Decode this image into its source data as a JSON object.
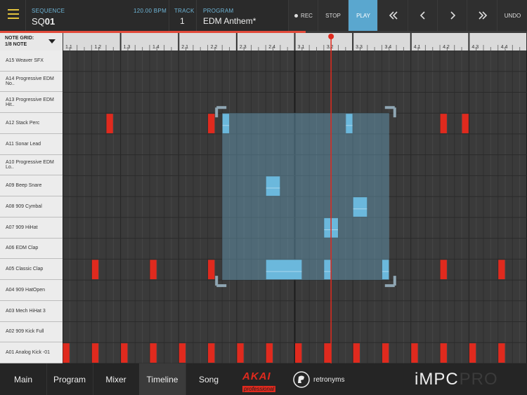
{
  "header": {
    "sequence_label": "SEQUENCE",
    "sequence_prefix": "SQ",
    "sequence_number": "01",
    "bpm": "120.00 BPM",
    "track_label": "TRACK",
    "track_value": "1",
    "program_label": "PROGRAM",
    "program_value": "EDM Anthem*",
    "rec_label": "REC",
    "stop_label": "STOP",
    "play_label": "PLAY",
    "undo_label": "UNDO",
    "song_progress": 0.58
  },
  "note_grid": {
    "label": "NOTE GRID:",
    "value": "1/8 NOTE"
  },
  "ruler": {
    "labels": [
      "1.1",
      "1.2",
      "1.3",
      "1.4",
      "2.1",
      "2.2",
      "2.3",
      "2.4",
      "3.1",
      "3.2",
      "3.3",
      "3.4",
      "4.1",
      "4.2",
      "4.3",
      "4.4"
    ],
    "playhead_step": 18.5
  },
  "pads": [
    "A15 Weaver SFX",
    "A14 Progressive EDM No..",
    "A13 Progressive EDM Hit..",
    "A12 Stack Perc",
    "A11 Sonar Lead",
    "A10 Progressive EDM Lo..",
    "A09 Beep Snare",
    "A08 909 Cymbal",
    "A07 909 HiHat",
    "A06 EDM Clap",
    "A05 Classic Clap",
    "A04 909 HatOpen",
    "A03 Mech HiHat 3",
    "A02 909 Kick Full",
    "A01 Analog Kick -01"
  ],
  "grid": {
    "steps": 32,
    "notes": [
      {
        "row": 3,
        "step": 3,
        "len": 0.5,
        "selected": false
      },
      {
        "row": 3,
        "step": 10,
        "len": 0.5,
        "selected": false
      },
      {
        "row": 3,
        "step": 11,
        "len": 0.5,
        "selected": true
      },
      {
        "row": 3,
        "step": 19.5,
        "len": 0.5,
        "selected": true
      },
      {
        "row": 3,
        "step": 26,
        "len": 0.5,
        "selected": false
      },
      {
        "row": 3,
        "step": 27.5,
        "len": 0.5,
        "selected": false
      },
      {
        "row": 6,
        "step": 14,
        "len": 1,
        "selected": true
      },
      {
        "row": 7,
        "step": 20,
        "len": 1,
        "selected": true
      },
      {
        "row": 8,
        "step": 18,
        "len": 1,
        "selected": true
      },
      {
        "row": 10,
        "step": 2,
        "len": 0.5,
        "selected": false
      },
      {
        "row": 10,
        "step": 6,
        "len": 0.5,
        "selected": false
      },
      {
        "row": 10,
        "step": 10,
        "len": 0.5,
        "selected": false
      },
      {
        "row": 10,
        "step": 14,
        "len": 2.5,
        "selected": true
      },
      {
        "row": 10,
        "step": 18,
        "len": 0.5,
        "selected": true
      },
      {
        "row": 10,
        "step": 22,
        "len": 0.5,
        "selected": true
      },
      {
        "row": 10,
        "step": 26,
        "len": 0.5,
        "selected": false
      },
      {
        "row": 10,
        "step": 30,
        "len": 0.5,
        "selected": false
      },
      {
        "row": 14,
        "step": 0,
        "len": 0.5,
        "selected": false
      },
      {
        "row": 14,
        "step": 2,
        "len": 0.5,
        "selected": false
      },
      {
        "row": 14,
        "step": 4,
        "len": 0.5,
        "selected": false
      },
      {
        "row": 14,
        "step": 6,
        "len": 0.5,
        "selected": false
      },
      {
        "row": 14,
        "step": 8,
        "len": 0.5,
        "selected": false
      },
      {
        "row": 14,
        "step": 10,
        "len": 0.5,
        "selected": false
      },
      {
        "row": 14,
        "step": 12,
        "len": 0.5,
        "selected": false
      },
      {
        "row": 14,
        "step": 14,
        "len": 0.5,
        "selected": false
      },
      {
        "row": 14,
        "step": 16,
        "len": 0.5,
        "selected": false
      },
      {
        "row": 14,
        "step": 18,
        "len": 0.5,
        "selected": false
      },
      {
        "row": 14,
        "step": 20,
        "len": 0.5,
        "selected": false
      },
      {
        "row": 14,
        "step": 22,
        "len": 0.5,
        "selected": false
      },
      {
        "row": 14,
        "step": 24,
        "len": 0.5,
        "selected": false
      },
      {
        "row": 14,
        "step": 26,
        "len": 0.5,
        "selected": false
      },
      {
        "row": 14,
        "step": 28,
        "len": 0.5,
        "selected": false
      },
      {
        "row": 14,
        "step": 30,
        "len": 0.5,
        "selected": false
      }
    ],
    "selection": {
      "step_start": 11,
      "step_end": 22.5,
      "row_start": 3,
      "row_end": 10
    }
  },
  "tabs": [
    "Main",
    "Program",
    "Mixer",
    "Timeline",
    "Song"
  ],
  "active_tab": "Timeline",
  "brands": {
    "akai_top": "AKAI",
    "akai_bottom": "professional",
    "retronyms": "retronyms",
    "impc": "iMPC",
    "pro": "PRO"
  },
  "colors": {
    "accent": "#5aa7cf",
    "note": "#e02a1e",
    "selected_note": "#6bb8dc",
    "menu": "#e2c33e"
  }
}
